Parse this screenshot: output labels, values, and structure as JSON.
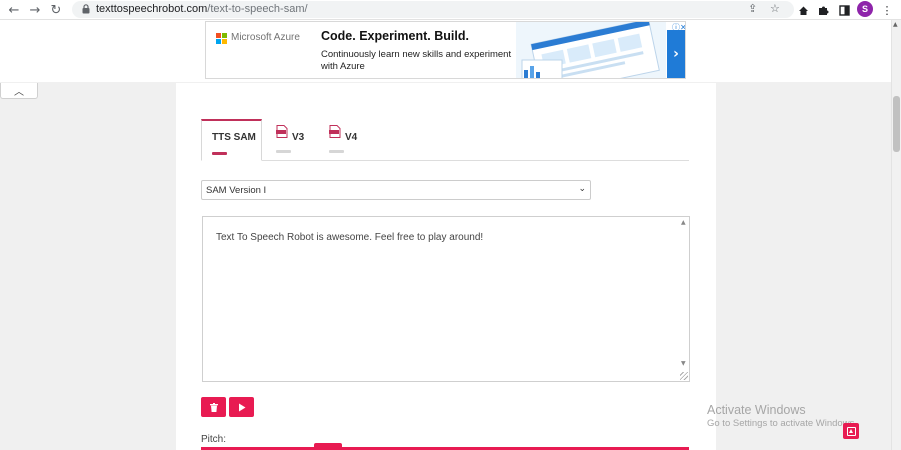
{
  "browser": {
    "url_domain": "texttospeechrobot.com",
    "url_path": "/text-to-speech-sam/",
    "profile_initial": "S",
    "icons": [
      "back-icon",
      "forward-icon",
      "reload-icon",
      "lock-icon",
      "share-icon",
      "star-icon",
      "extension-icon",
      "puzzle-icon",
      "sidebar-icon",
      "menu-icon"
    ]
  },
  "ad": {
    "brand": "Microsoft Azure",
    "headline": "Code. Experiment. Build.",
    "body": "Continuously learn new skills and experiment with Azure",
    "adchoices": "ⓘ✕",
    "next": "›",
    "logo_colors": [
      "#f25022",
      "#7fba00",
      "#00a4ef",
      "#ffb900"
    ]
  },
  "tabs": [
    {
      "label": "TTS SAM",
      "active": true,
      "bar_color": "#c0305a"
    },
    {
      "label": "V3",
      "active": false,
      "bar_color": "#d6d6d6"
    },
    {
      "label": "V4",
      "active": false,
      "bar_color": "#d6d6d6"
    }
  ],
  "version_select": {
    "value": "SAM Version I"
  },
  "text_input": {
    "value": "Text To Speech Robot is awesome. Feel free to play around!"
  },
  "pitch": {
    "label": "Pitch:",
    "value_fraction": 0.26
  },
  "accent_color": "#e81b52",
  "windows": {
    "title": "Activate Windows",
    "subtitle": "Go to Settings to activate Windows."
  }
}
